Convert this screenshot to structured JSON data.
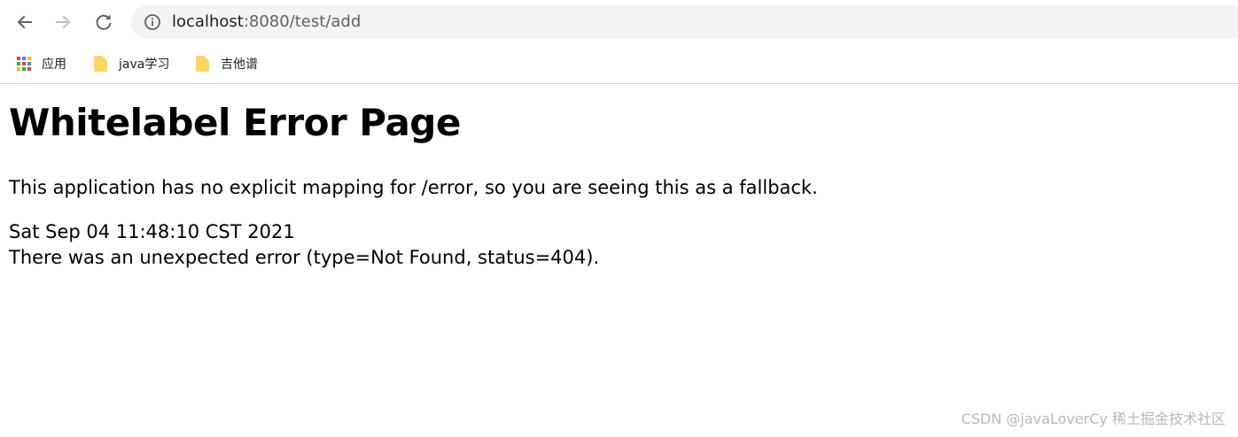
{
  "browser": {
    "url_host": "localhost",
    "url_path": ":8080/test/add",
    "bookmarks": [
      {
        "label": "应用",
        "icon": "apps-grid-icon"
      },
      {
        "label": "java学习",
        "icon": "folder-icon"
      },
      {
        "label": "吉他谱",
        "icon": "folder-icon"
      }
    ]
  },
  "page": {
    "title": "Whitelabel Error Page",
    "description": "This application has no explicit mapping for /error, so you are seeing this as a fallback.",
    "timestamp": "Sat Sep 04 11:48:10 CST 2021",
    "error_message": "There was an unexpected error (type=Not Found, status=404)."
  },
  "watermark": "CSDN @javaLoverCy 稀土掘金技术社区",
  "colors": {
    "omnibox_bg": "#f1f3f4",
    "folder": "#fdd663",
    "text": "#000000"
  }
}
